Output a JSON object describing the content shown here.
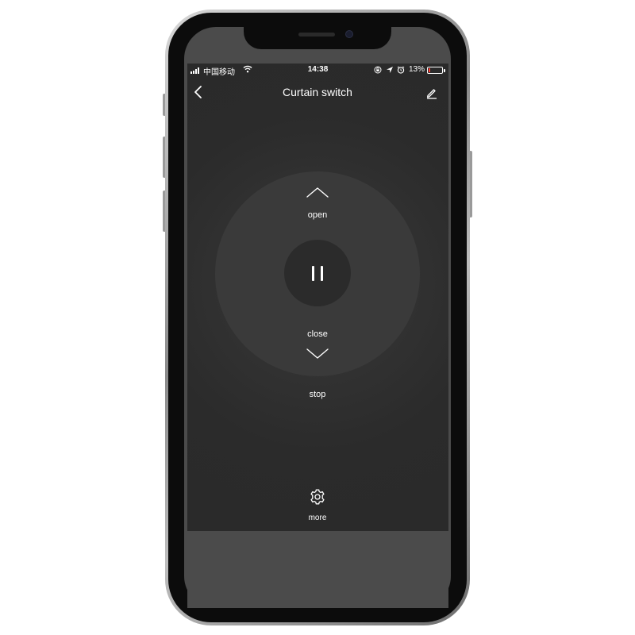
{
  "status_bar": {
    "carrier": "中国移动",
    "time": "14:38",
    "battery_percent": "13%",
    "battery_color": "#ff3b30",
    "icons": [
      "signal-icon",
      "wifi-icon",
      "rotation-lock-icon",
      "location-icon",
      "alarm-icon",
      "battery-icon"
    ]
  },
  "nav": {
    "title": "Curtain switch",
    "back_icon": "chevron-left-icon",
    "edit_icon": "pencil-icon"
  },
  "controller": {
    "open_label": "open",
    "close_label": "close",
    "stop_label": "stop",
    "up_icon": "chevron-up-icon",
    "down_icon": "chevron-down-icon",
    "pause_icon": "pause-icon"
  },
  "footer": {
    "more_label": "more",
    "more_icon": "gear-icon"
  },
  "colors": {
    "app_background": "#2a2a2a",
    "ring": "#3a3a3a",
    "center_button": "#2b2b2b",
    "text": "#ffffff"
  }
}
